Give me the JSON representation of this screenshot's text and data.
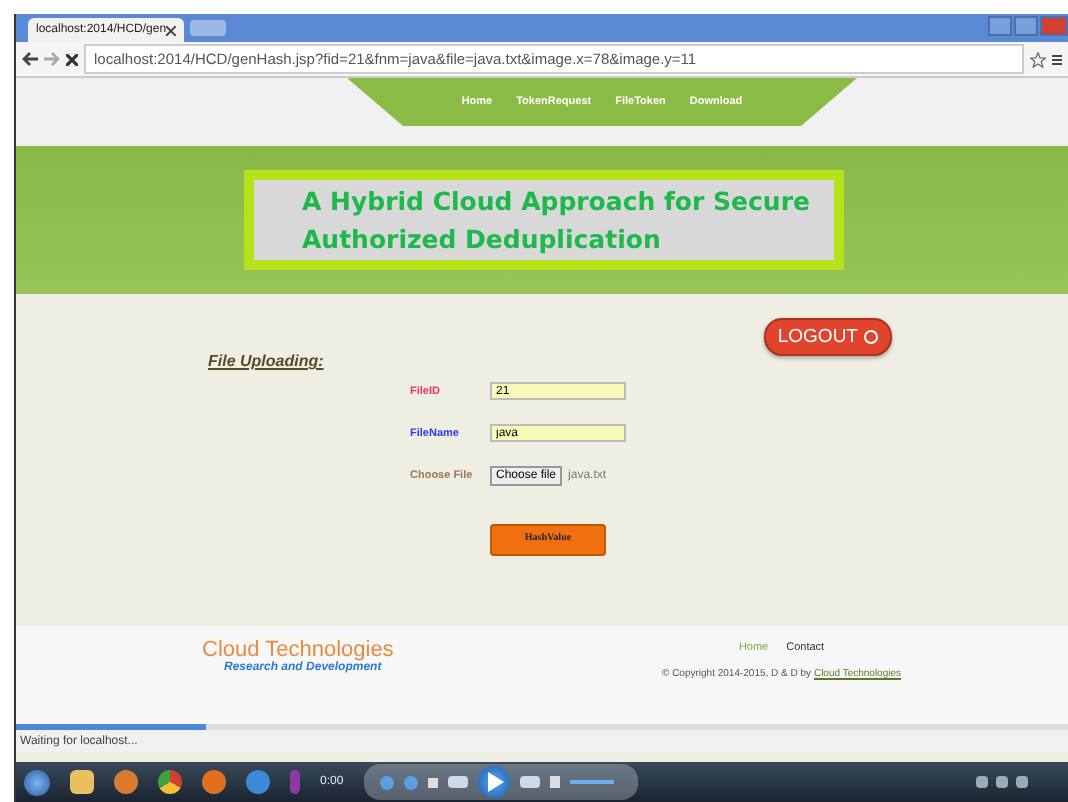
{
  "browser": {
    "tab_title": "localhost:2014/HCD/gen",
    "url": "localhost:2014/HCD/genHash.jsp?fid=21&fnm=java&file=java.txt&image.x=78&image.y=11",
    "loading": {
      "level": 0.18
    },
    "status": "Waiting for localhost..."
  },
  "nav": [
    {
      "label": "Home"
    },
    {
      "label": "TokenRequest"
    },
    {
      "label": "FileToken"
    },
    {
      "label": "Download"
    }
  ],
  "banner": {
    "title": "A Hybrid Cloud Approach for Secure Authorized Deduplication"
  },
  "logout": {
    "label": "LOGOUT"
  },
  "form": {
    "heading": "File Uploading:",
    "fields": [
      {
        "kind": "text",
        "label": "FileID",
        "value": "21",
        "color": "#f0306a"
      },
      {
        "kind": "text",
        "label": "FileName",
        "value": "java",
        "color": "#2a3cf0"
      },
      {
        "kind": "file",
        "label": "Choose File",
        "button": "Choose file",
        "value": "java.txt",
        "color": "#9a7a50"
      }
    ],
    "submit": "HashValue"
  },
  "footer": {
    "brand": "Cloud Technologies",
    "tagline": "Research and Development",
    "links": [
      {
        "label": "Home",
        "selected": true
      },
      {
        "label": "Contact",
        "selected": false
      }
    ],
    "copyright": "© Copyright 2014-2015, D & D by",
    "copyright_link": "Cloud Technologies"
  },
  "player": {
    "time": "0:00",
    "volume": {
      "level": 0.85
    }
  }
}
